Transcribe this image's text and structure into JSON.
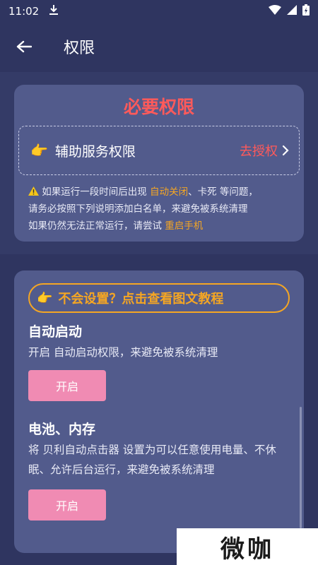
{
  "status_bar": {
    "time": "11:02"
  },
  "app_bar": {
    "title": "权限"
  },
  "required": {
    "title": "必要权限",
    "item_label": "辅助服务权限",
    "item_action": "去授权",
    "warning": {
      "line1_pre": "如果运行一段时间后出现 ",
      "line1_hl": "自动关闭",
      "line1_post": "、卡死 等问题，",
      "line2": "请务必按照下列说明添加白名单，来避免被系统清理",
      "line3_pre": "如果仍然无法正常运行，请尝试 ",
      "line3_hl": "重启手机"
    }
  },
  "tutorial": {
    "label": "不会设置？点击查看图文教程"
  },
  "settings": {
    "auto_start": {
      "title": "自动启动",
      "desc": "开启 自动启动权限，来避免被系统清理",
      "button": "开启"
    },
    "battery": {
      "title": "电池、内存",
      "desc": "将 贝利自动点击器 设置为可以任意使用电量、不休眠、允许后台运行，来避免被系统清理",
      "button": "开启"
    }
  },
  "watermark": "微咖",
  "colors": {
    "background": "#2f3560",
    "card": "#525b8c",
    "red_accent": "#ff5a5a",
    "orange_accent": "#f5a623",
    "pink_button": "#f08bb3"
  }
}
